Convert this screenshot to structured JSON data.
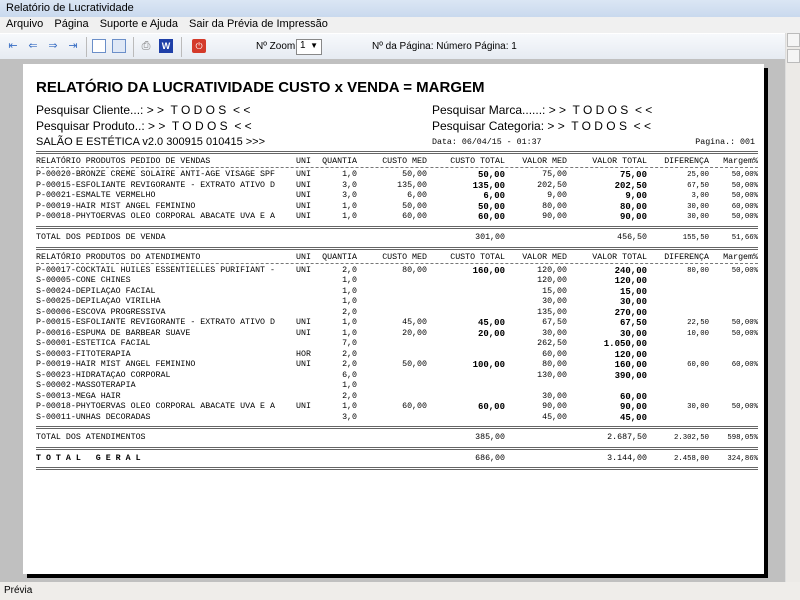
{
  "window": {
    "title": "Relatório de Lucratividade"
  },
  "menu": [
    "Arquivo",
    "Página",
    "Suporte e Ajuda",
    "Sair da Prévia de Impressão"
  ],
  "toolbar": {
    "zoom_label": "Nº Zoom",
    "zoom_value": "1",
    "page_label": "Nº da Página: Número Página: 1"
  },
  "status": "Prévia",
  "report": {
    "title": "RELATÓRIO DA LUCRATIVIDADE CUSTO x VENDA = MARGEM",
    "filters": {
      "cliente": "Pesquisar Cliente...: > >  T O D O S  < <",
      "produto": "Pesquisar Produto..: > >  T O D O S  < <",
      "marca": "Pesquisar Marca......: > >  T O D O S  < <",
      "categoria": "Pesquisar Categoria: > >  T O D O S  < <"
    },
    "system": "SALÃO E ESTÉTICA v2.0 300915 010415 >>>",
    "date": "Data: 06/04/15 - 01:37",
    "page": "Pagina.: 001",
    "columns": [
      "UNI",
      "QUANTIA",
      "CUSTO MED",
      "CUSTO TOTAL",
      "VALOR MED",
      "VALOR TOTAL",
      "DIFERENÇA",
      "Margem%"
    ],
    "sections": [
      {
        "heading": "RELATÓRIO PRODUTOS PEDIDO DE VENDAS",
        "rows": [
          [
            "P-00020-BRONZE CRÈME SOLAIRE ANTI-AGE VISAGE SPF",
            "UNI",
            "1,0",
            "50,00",
            "50,00",
            "75,00",
            "75,00",
            "25,00",
            "50,00%"
          ],
          [
            "P-00015-ESFOLIANTE REVIGORANTE - EXTRATO ATIVO D",
            "UNI",
            "3,0",
            "135,00",
            "135,00",
            "202,50",
            "202,50",
            "67,50",
            "50,00%"
          ],
          [
            "P-00021-ESMALTE VERMELHO",
            "UNI",
            "3,0",
            "6,00",
            "6,00",
            "9,00",
            "9,00",
            "3,00",
            "50,00%"
          ],
          [
            "P-00019-HAIR MIST ANGEL FEMININO",
            "UNI",
            "1,0",
            "50,00",
            "50,00",
            "80,00",
            "80,00",
            "30,00",
            "60,00%"
          ],
          [
            "P-00018-PHYTOERVAS OLEO CORPORAL ABACATE UVA E A",
            "UNI",
            "1,0",
            "60,00",
            "60,00",
            "90,00",
            "90,00",
            "30,00",
            "50,00%"
          ]
        ],
        "total": {
          "label": "TOTAL DOS PEDIDOS DE VENDA",
          "custo_total": "301,00",
          "valor_total": "456,50",
          "diferenca": "155,50",
          "margem": "51,66%"
        }
      },
      {
        "heading": "RELATÓRIO PRODUTOS DO ATENDIMENTO",
        "rows": [
          [
            "P-00017-COCKTAIL HUILES ESSENTIELLES PURIFIANT -",
            "UNI",
            "2,0",
            "80,00",
            "160,00",
            "120,00",
            "240,00",
            "80,00",
            "50,00%"
          ],
          [
            "S-00005-CONE CHINES",
            "",
            "1,0",
            "",
            "",
            "120,00",
            "120,00",
            "",
            ""
          ],
          [
            "S-00024-DEPILAÇÃO FACIAL",
            "",
            "1,0",
            "",
            "",
            "15,00",
            "15,00",
            "",
            ""
          ],
          [
            "S-00025-DEPILAÇÃO VIRILHA",
            "",
            "1,0",
            "",
            "",
            "30,00",
            "30,00",
            "",
            ""
          ],
          [
            "S-00006-ESCOVA PROGRESSIVA",
            "",
            "2,0",
            "",
            "",
            "135,00",
            "270,00",
            "",
            ""
          ],
          [
            "P-00015-ESFOLIANTE REVIGORANTE - EXTRATO ATIVO D",
            "UNI",
            "1,0",
            "45,00",
            "45,00",
            "67,50",
            "67,50",
            "22,50",
            "50,00%"
          ],
          [
            "P-00016-ESPUMA DE BARBEAR SUAVE",
            "UNI",
            "1,0",
            "20,00",
            "20,00",
            "30,00",
            "30,00",
            "10,00",
            "50,00%"
          ],
          [
            "S-00001-ESTÉTICA FACIAL",
            "",
            "7,0",
            "",
            "",
            "262,50",
            "1.050,00",
            "",
            ""
          ],
          [
            "S-00003-FITOTERAPIA",
            "HOR",
            "2,0",
            "",
            "",
            "60,00",
            "120,00",
            "",
            ""
          ],
          [
            "P-00019-HAIR MIST ANGEL FEMININO",
            "UNI",
            "2,0",
            "50,00",
            "100,00",
            "80,00",
            "160,00",
            "60,00",
            "60,00%"
          ],
          [
            "S-00023-HIDRATAÇÃO CORPORAL",
            "",
            "6,0",
            "",
            "",
            "130,00",
            "390,00",
            "",
            ""
          ],
          [
            "S-00002-MASSOTERAPIA",
            "",
            "1,0",
            "",
            "",
            "",
            "",
            "",
            ""
          ],
          [
            "S-00013-MEGA HAIR",
            "",
            "2,0",
            "",
            "",
            "30,00",
            "60,00",
            "",
            ""
          ],
          [
            "P-00018-PHYTOERVAS OLEO CORPORAL ABACATE UVA E A",
            "UNI",
            "1,0",
            "60,00",
            "60,00",
            "90,00",
            "90,00",
            "30,00",
            "50,00%"
          ],
          [
            "S-00011-UNHAS DECORADAS",
            "",
            "3,0",
            "",
            "",
            "45,00",
            "45,00",
            "",
            ""
          ]
        ],
        "total": {
          "label": "TOTAL DOS ATENDIMENTOS",
          "custo_total": "385,00",
          "valor_total": "2.687,50",
          "diferenca": "2.302,50",
          "margem": "598,05%"
        }
      }
    ],
    "grand_total": {
      "label": "T O T A L   G E R A L",
      "custo_total": "686,00",
      "valor_total": "3.144,00",
      "diferenca": "2.458,00",
      "margem": "324,86%"
    }
  }
}
